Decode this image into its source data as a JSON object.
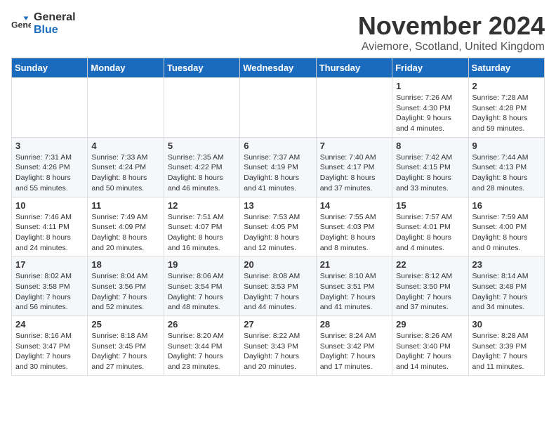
{
  "logo": {
    "general": "General",
    "blue": "Blue"
  },
  "header": {
    "month": "November 2024",
    "location": "Aviemore, Scotland, United Kingdom"
  },
  "weekdays": [
    "Sunday",
    "Monday",
    "Tuesday",
    "Wednesday",
    "Thursday",
    "Friday",
    "Saturday"
  ],
  "weeks": [
    [
      {
        "day": "",
        "info": ""
      },
      {
        "day": "",
        "info": ""
      },
      {
        "day": "",
        "info": ""
      },
      {
        "day": "",
        "info": ""
      },
      {
        "day": "",
        "info": ""
      },
      {
        "day": "1",
        "info": "Sunrise: 7:26 AM\nSunset: 4:30 PM\nDaylight: 9 hours\nand 4 minutes."
      },
      {
        "day": "2",
        "info": "Sunrise: 7:28 AM\nSunset: 4:28 PM\nDaylight: 8 hours\nand 59 minutes."
      }
    ],
    [
      {
        "day": "3",
        "info": "Sunrise: 7:31 AM\nSunset: 4:26 PM\nDaylight: 8 hours\nand 55 minutes."
      },
      {
        "day": "4",
        "info": "Sunrise: 7:33 AM\nSunset: 4:24 PM\nDaylight: 8 hours\nand 50 minutes."
      },
      {
        "day": "5",
        "info": "Sunrise: 7:35 AM\nSunset: 4:22 PM\nDaylight: 8 hours\nand 46 minutes."
      },
      {
        "day": "6",
        "info": "Sunrise: 7:37 AM\nSunset: 4:19 PM\nDaylight: 8 hours\nand 41 minutes."
      },
      {
        "day": "7",
        "info": "Sunrise: 7:40 AM\nSunset: 4:17 PM\nDaylight: 8 hours\nand 37 minutes."
      },
      {
        "day": "8",
        "info": "Sunrise: 7:42 AM\nSunset: 4:15 PM\nDaylight: 8 hours\nand 33 minutes."
      },
      {
        "day": "9",
        "info": "Sunrise: 7:44 AM\nSunset: 4:13 PM\nDaylight: 8 hours\nand 28 minutes."
      }
    ],
    [
      {
        "day": "10",
        "info": "Sunrise: 7:46 AM\nSunset: 4:11 PM\nDaylight: 8 hours\nand 24 minutes."
      },
      {
        "day": "11",
        "info": "Sunrise: 7:49 AM\nSunset: 4:09 PM\nDaylight: 8 hours\nand 20 minutes."
      },
      {
        "day": "12",
        "info": "Sunrise: 7:51 AM\nSunset: 4:07 PM\nDaylight: 8 hours\nand 16 minutes."
      },
      {
        "day": "13",
        "info": "Sunrise: 7:53 AM\nSunset: 4:05 PM\nDaylight: 8 hours\nand 12 minutes."
      },
      {
        "day": "14",
        "info": "Sunrise: 7:55 AM\nSunset: 4:03 PM\nDaylight: 8 hours\nand 8 minutes."
      },
      {
        "day": "15",
        "info": "Sunrise: 7:57 AM\nSunset: 4:01 PM\nDaylight: 8 hours\nand 4 minutes."
      },
      {
        "day": "16",
        "info": "Sunrise: 7:59 AM\nSunset: 4:00 PM\nDaylight: 8 hours\nand 0 minutes."
      }
    ],
    [
      {
        "day": "17",
        "info": "Sunrise: 8:02 AM\nSunset: 3:58 PM\nDaylight: 7 hours\nand 56 minutes."
      },
      {
        "day": "18",
        "info": "Sunrise: 8:04 AM\nSunset: 3:56 PM\nDaylight: 7 hours\nand 52 minutes."
      },
      {
        "day": "19",
        "info": "Sunrise: 8:06 AM\nSunset: 3:54 PM\nDaylight: 7 hours\nand 48 minutes."
      },
      {
        "day": "20",
        "info": "Sunrise: 8:08 AM\nSunset: 3:53 PM\nDaylight: 7 hours\nand 44 minutes."
      },
      {
        "day": "21",
        "info": "Sunrise: 8:10 AM\nSunset: 3:51 PM\nDaylight: 7 hours\nand 41 minutes."
      },
      {
        "day": "22",
        "info": "Sunrise: 8:12 AM\nSunset: 3:50 PM\nDaylight: 7 hours\nand 37 minutes."
      },
      {
        "day": "23",
        "info": "Sunrise: 8:14 AM\nSunset: 3:48 PM\nDaylight: 7 hours\nand 34 minutes."
      }
    ],
    [
      {
        "day": "24",
        "info": "Sunrise: 8:16 AM\nSunset: 3:47 PM\nDaylight: 7 hours\nand 30 minutes."
      },
      {
        "day": "25",
        "info": "Sunrise: 8:18 AM\nSunset: 3:45 PM\nDaylight: 7 hours\nand 27 minutes."
      },
      {
        "day": "26",
        "info": "Sunrise: 8:20 AM\nSunset: 3:44 PM\nDaylight: 7 hours\nand 23 minutes."
      },
      {
        "day": "27",
        "info": "Sunrise: 8:22 AM\nSunset: 3:43 PM\nDaylight: 7 hours\nand 20 minutes."
      },
      {
        "day": "28",
        "info": "Sunrise: 8:24 AM\nSunset: 3:42 PM\nDaylight: 7 hours\nand 17 minutes."
      },
      {
        "day": "29",
        "info": "Sunrise: 8:26 AM\nSunset: 3:40 PM\nDaylight: 7 hours\nand 14 minutes."
      },
      {
        "day": "30",
        "info": "Sunrise: 8:28 AM\nSunset: 3:39 PM\nDaylight: 7 hours\nand 11 minutes."
      }
    ]
  ]
}
